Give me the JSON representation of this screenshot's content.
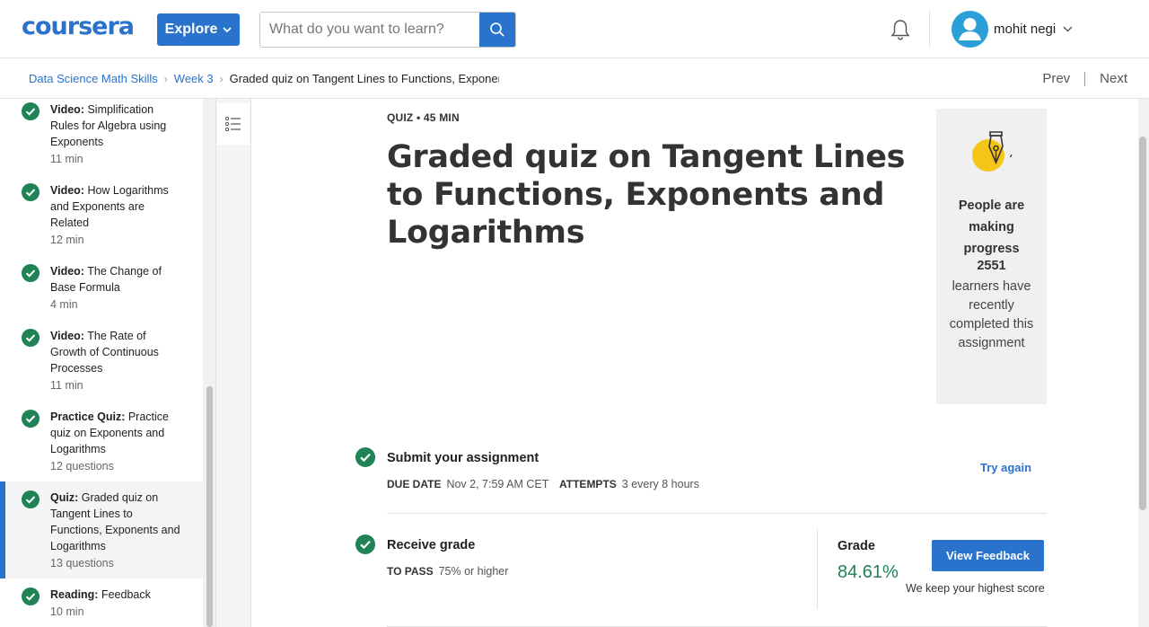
{
  "header": {
    "logo": "coursera",
    "explore_label": "Explore",
    "search_placeholder": "What do you want to learn?",
    "user_name": "mohit negi",
    "icons": {
      "search": "search-icon",
      "notifications": "bell-icon",
      "avatar": "user-avatar-icon",
      "menu": "chevron-down-icon"
    },
    "brand_color": "#2a73cc"
  },
  "breadcrumb": {
    "items": [
      "Data Science Math Skills",
      "Week 3"
    ],
    "current": "Graded quiz on Tangent Lines to Functions, Exponents and Logarithms",
    "prev": "Prev",
    "next": "Next"
  },
  "sidebar": {
    "items": [
      {
        "type": "Video:",
        "title": " Simplification Rules for Algebra using Exponents",
        "meta": "11 min",
        "completed": true,
        "active": false
      },
      {
        "type": "Video:",
        "title": " How Logarithms and Exponents are Related",
        "meta": "12 min",
        "completed": true,
        "active": false
      },
      {
        "type": "Video:",
        "title": " The Change of Base Formula",
        "meta": "4 min",
        "completed": true,
        "active": false
      },
      {
        "type": "Video:",
        "title": " The Rate of Growth of Continuous Processes",
        "meta": "11 min",
        "completed": true,
        "active": false
      },
      {
        "type": "Practice Quiz:",
        "title": " Practice quiz on Exponents and Logarithms",
        "meta": "12 questions",
        "completed": true,
        "active": false
      },
      {
        "type": "Quiz:",
        "title": " Graded quiz on Tangent Lines to Functions, Exponents and Logarithms",
        "meta": "13 questions",
        "completed": true,
        "active": true
      },
      {
        "type": "Reading:",
        "title": " Feedback",
        "meta": "10 min",
        "completed": true,
        "active": false
      }
    ]
  },
  "main": {
    "meta": "QUIZ • 45 MIN",
    "title": "Graded quiz on Tangent Lines to Functions, Exponents and Logarithms",
    "progress_card": {
      "heading": "People are making progress",
      "count": "2551",
      "text": "learners have recently completed this assignment"
    },
    "submit": {
      "title": "Submit your assignment",
      "due_label": "DUE DATE",
      "due_value": "Nov 2, 7:59 AM CET",
      "attempts_label": "ATTEMPTS",
      "attempts_value": "3 every 8 hours",
      "action": "Try again"
    },
    "grade": {
      "title": "Receive grade",
      "pass_label": "TO PASS",
      "pass_value": "75% or higher",
      "grade_label": "Grade",
      "grade_value": "84.61%",
      "feedback_button": "View Feedback",
      "note": "We keep your highest score"
    },
    "success_color": "#1f8355"
  }
}
